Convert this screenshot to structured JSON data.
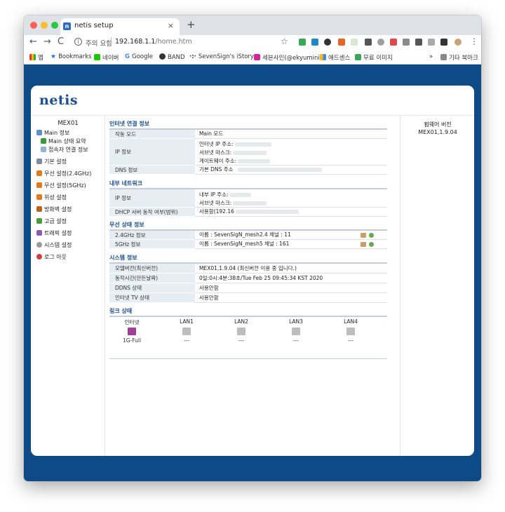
{
  "browser": {
    "tab_title": "netis setup",
    "tab_close": "×",
    "new_tab": "+",
    "back": "←",
    "forward": "→",
    "reload": "C",
    "security_text": "주의 요함",
    "url_host": "192.168.1.1",
    "url_path": "/home.htm",
    "menu": "⋮",
    "bookmarks": [
      "앱",
      "Bookmarks",
      "네이버",
      "Google",
      "BAND",
      "SevenSign's iStory ::",
      "세븐사인(@ekyumini...",
      "애드센스",
      "무료 이미지"
    ],
    "bookmarks_more": "»",
    "other_bookmarks": "기타 북마크"
  },
  "router": {
    "logo": "netis",
    "model": "MEX01",
    "menu": [
      "Main 정보",
      "Main 상태 요약",
      "접속자 연결 정보",
      "기본 설정",
      "무선 설정(2.4GHz)",
      "무선 설정(5GHz)",
      "위성 설정",
      "방화벽 설정",
      "고급 설정",
      "트래픽 설정",
      "시스템 설정",
      "로그 아웃"
    ],
    "firmware_label": "펌웨어 버전",
    "firmware_value": "MEX01,1.9.04"
  },
  "internet": {
    "title": "인터넷 연결 정보",
    "mode_label": "작동 모드",
    "mode_value": "Main 모드",
    "ip_label": "IP 정보",
    "ip_lines": [
      "인터넷 IP 주소:",
      "서브넷 마스크:",
      "게이트웨이 주소:"
    ],
    "dns_label": "DNS 정보",
    "dns_value": "기본 DNS 주소"
  },
  "lan": {
    "title": "내부 네트워크",
    "ip_label": "IP 정보",
    "ip_lines": [
      "내부 IP 주소:",
      "서브넷 마스크:"
    ],
    "dhcp_label": "DHCP 서버 동작 여부(범위)",
    "dhcp_value": "사용함(192.16"
  },
  "wireless": {
    "title": "무선 상태 정보",
    "rows": [
      {
        "label": "2.4GHz 정보",
        "value": "이름 : SevenSigN_mesh2.4 채널 : 11"
      },
      {
        "label": "5GHz 정보",
        "value": "이름 : SevenSigN_mesh5 채널 : 161"
      }
    ]
  },
  "system": {
    "title": "시스템 정보",
    "rows": [
      {
        "label": "모델버전(최신버전)",
        "value": "MEX01,1.9.04 (최신버전 이용 중 입니다.)"
      },
      {
        "label": "동작시간(만든날짜)",
        "value": "0일:0시:4분:38초/Tue Feb 25 09:45:34 KST 2020"
      },
      {
        "label": "DDNS 상태",
        "value": "사용안함"
      },
      {
        "label": "인터넷 TV 상태",
        "value": "사용안함"
      }
    ]
  },
  "link": {
    "title": "링크 상태",
    "ports": [
      {
        "label": "인터넷",
        "status": "1G-Full",
        "active": true
      },
      {
        "label": "LAN1",
        "status": "---",
        "active": false
      },
      {
        "label": "LAN2",
        "status": "---",
        "active": false
      },
      {
        "label": "LAN3",
        "status": "---",
        "active": false
      },
      {
        "label": "LAN4",
        "status": "---",
        "active": false
      }
    ]
  },
  "colors": {
    "page_bg": "#0e4a85",
    "accent": "#1a4f92",
    "port_active": "#a03f98",
    "port_inactive": "#bdbdbd"
  }
}
